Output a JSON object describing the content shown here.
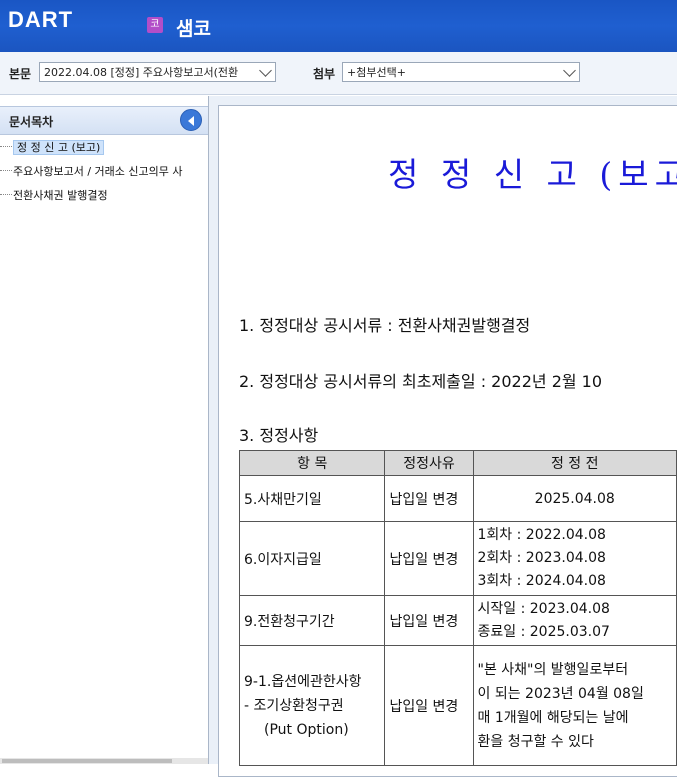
{
  "header": {
    "logo": "DART",
    "company_badge": "코",
    "company_name": "샘코"
  },
  "toolbar": {
    "main_label": "본문",
    "main_select": "2022.04.08 [정정] 주요사항보고서(전환",
    "attach_label": "첨부",
    "attach_select": "+첨부선택+"
  },
  "sidebar": {
    "title": "문서목차",
    "items": [
      {
        "label": "정 정 신 고 (보고)"
      },
      {
        "label": "주요사항보고서 / 거래소 신고의무 사"
      },
      {
        "label": "전환사채권 발행결정"
      }
    ]
  },
  "document": {
    "title": "정 정 신 고 (보고",
    "line1": "1. 정정대상 공시서류 : 전환사채권발행결정",
    "line2": "2. 정정대상 공시서류의 최초제출일 : 2022년 2월 10",
    "line3": "3. 정정사항",
    "table": {
      "headers": [
        "항 목",
        "정정사유",
        "정 정 전"
      ],
      "rows": [
        {
          "item": [
            "5.사채만기일"
          ],
          "reason": "납입일 변경",
          "before": [
            "2025.04.08"
          ]
        },
        {
          "item": [
            "6.이자지급일"
          ],
          "reason": "납입일 변경",
          "before": [
            "1회차 : 2022.04.08",
            "2회차 : 2023.04.08",
            "3회차 : 2024.04.08"
          ]
        },
        {
          "item": [
            "9.전환청구기간"
          ],
          "reason": "납입일 변경",
          "before": [
            "시작일 : 2023.04.08",
            "종료일 : 2025.03.07"
          ]
        },
        {
          "item": [
            "9-1.옵션에관한사항",
            "- 조기상환청구권",
            "(Put Option)"
          ],
          "reason": "납입일 변경",
          "before": [
            "\"본 사채\"의 발행일로부터",
            "이 되는 2023년 04월 08일",
            "매 1개월에 해당되는 날에",
            "환을 청구할 수 있다"
          ]
        }
      ]
    }
  }
}
